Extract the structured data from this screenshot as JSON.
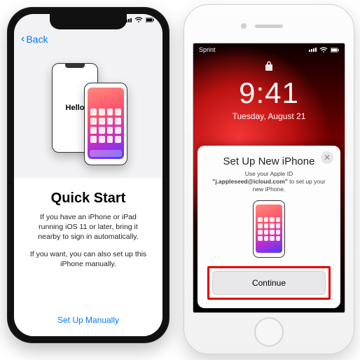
{
  "left": {
    "back_label": "Back",
    "hello_text": "Hello",
    "title": "Quick Start",
    "paragraph1": "If you have an iPhone or iPad running iOS 11 or later, bring it nearby to sign in automatically.",
    "paragraph2": "If you want, you can also set up this iPhone manually.",
    "manual_link": "Set Up Manually"
  },
  "right": {
    "carrier": "Sprint",
    "lock_time": "9:41",
    "lock_date": "Tuesday, August 21",
    "sheet_title": "Set Up New iPhone",
    "sheet_sub_prefix": "Use your Apple ID ",
    "sheet_sub_email": "\"j.appleseed@icloud.com\"",
    "sheet_sub_suffix": " to set up your new iPhone.",
    "continue_label": "Continue"
  }
}
